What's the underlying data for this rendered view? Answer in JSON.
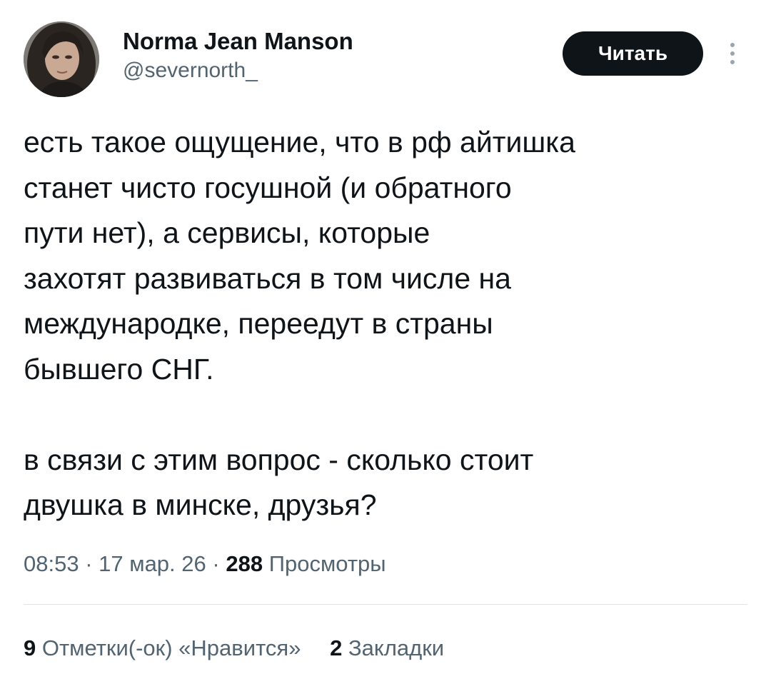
{
  "author": {
    "display_name": "Norma Jean Manson",
    "handle": "@severnorth_"
  },
  "actions": {
    "follow_label": "Читать",
    "more_icon": "vertical-ellipsis-icon"
  },
  "tweet": {
    "paragraph1": [
      "есть такое ощущение, что в рф айтишка",
      "станет чисто госушной (и обратного",
      "пути нет), а сервисы, которые",
      "захотят развиваться в том числе на",
      "международке, переедут в страны",
      "бывшего СНГ."
    ],
    "paragraph2": [
      "в связи с этим вопрос - сколько стоит",
      "двушка в минске, друзья?"
    ]
  },
  "meta": {
    "time": "08:53",
    "separator": "·",
    "date": "17 мар. 26",
    "views_count": "288",
    "views_label": "Просмотры"
  },
  "stats": {
    "likes_count": "9",
    "likes_label": "Отметки(-ок) «Нравится»",
    "bookmarks_count": "2",
    "bookmarks_label": "Закладки"
  },
  "colors": {
    "primary_text": "#0f1419",
    "secondary_text": "#536471",
    "button_bg": "#0f1419",
    "divider": "#dfe3e6"
  }
}
